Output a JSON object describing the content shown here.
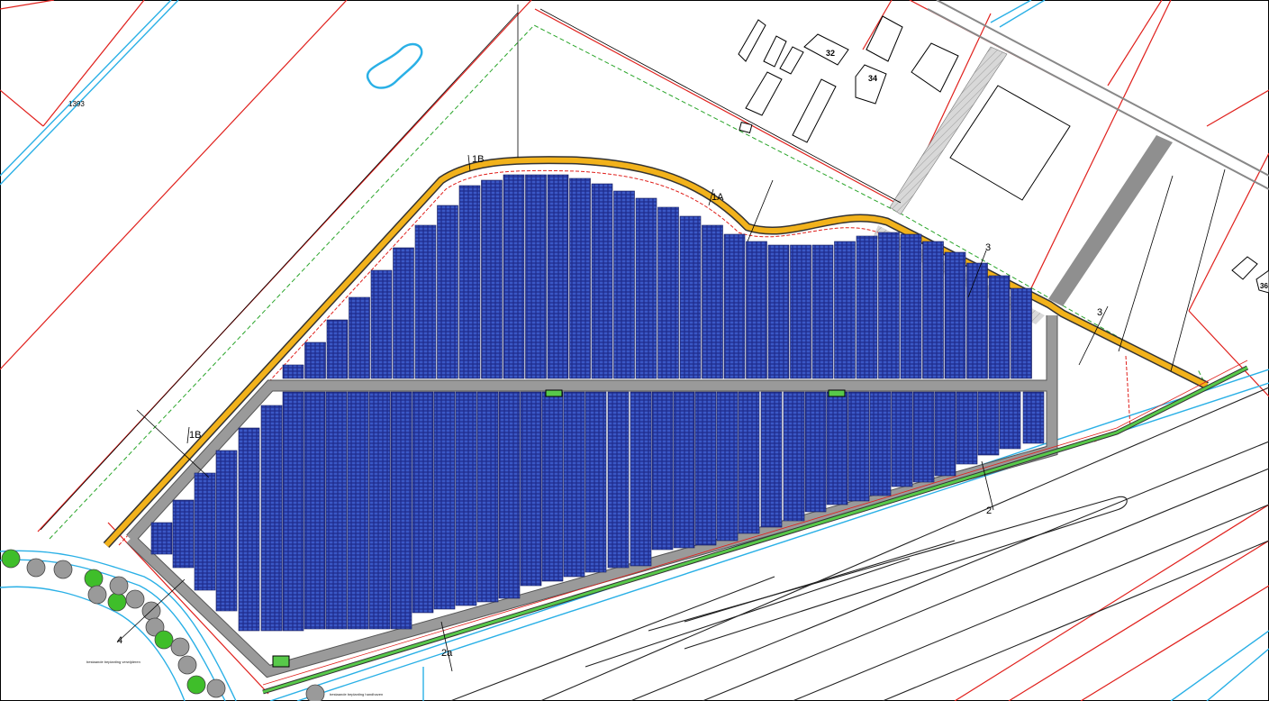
{
  "map": {
    "parcel_number": "1393",
    "house_numbers": [
      "32",
      "34",
      "36"
    ],
    "section_labels": {
      "one_a": "1A",
      "one_b_top": "1B",
      "one_b_left": "1B",
      "two": "2",
      "two_a": "2a",
      "three_top": "3",
      "three_right": "3",
      "four": "4"
    },
    "annotations": {
      "existing_planting_1": "bestaande beplanting verwijderen",
      "existing_planting_2": "bestaande beplanting handhaven"
    },
    "colors": {
      "solar_panel": "#1e2a8a",
      "solar_panel_grid": "#4f78d8",
      "road": "#9a9a9a",
      "hedge": "#f2b21b",
      "cadastral": "#e0201c",
      "water": "#2ab0e6",
      "boundary_dashed": "#2aa52a",
      "green_strip": "#58c94a"
    },
    "legend_symbols": [
      "transformer-station",
      "inverter-station",
      "inverter-station",
      "entrance-station"
    ]
  }
}
